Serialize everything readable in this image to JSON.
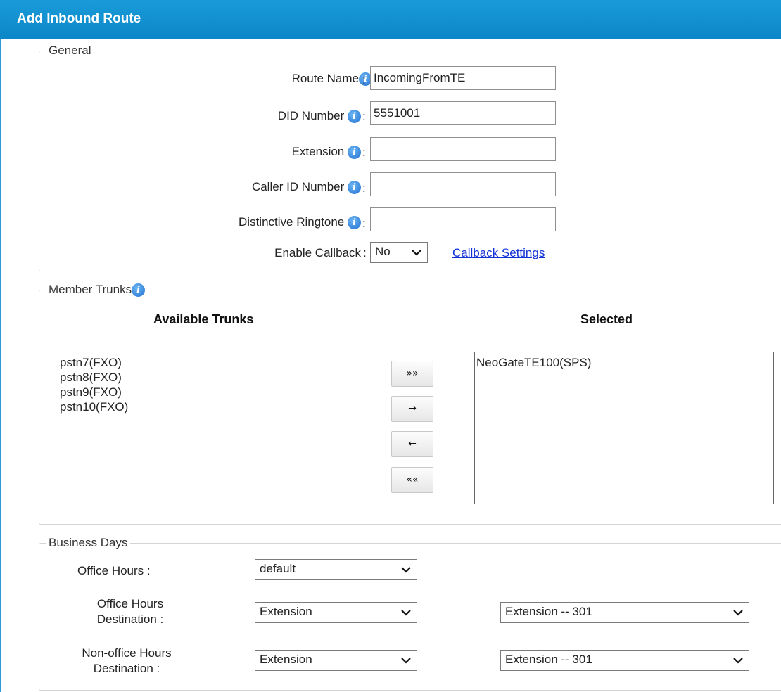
{
  "header": {
    "title": "Add Inbound Route"
  },
  "general": {
    "legend": "General",
    "route_name": {
      "label": "Route Name",
      "value": "IncomingFromTE"
    },
    "did_number": {
      "label": "DID Number",
      "value": "5551001"
    },
    "extension": {
      "label": "Extension",
      "value": ""
    },
    "caller_id_number": {
      "label": "Caller ID Number",
      "value": ""
    },
    "distinctive_ringtone": {
      "label": "Distinctive Ringtone",
      "value": ""
    },
    "enable_callback": {
      "label": "Enable Callback",
      "value": "No"
    },
    "callback_settings_link": "Callback Settings",
    "colon": ":"
  },
  "member_trunks": {
    "legend": "Member Trunks",
    "available_heading": "Available Trunks",
    "selected_heading": "Selected",
    "available": [
      "pstn7(FXO)",
      "pstn8(FXO)",
      "pstn9(FXO)",
      "pstn10(FXO)"
    ],
    "selected": [
      "NeoGateTE100(SPS)"
    ],
    "buttons": {
      "add_all": "»»",
      "add": "→",
      "remove": "←",
      "remove_all": "««"
    }
  },
  "business_days": {
    "legend": "Business Days",
    "office_hours": {
      "label": "Office Hours :",
      "value": "default"
    },
    "office_hours_destination": {
      "label_line1": "Office Hours",
      "label_line2": "Destination :",
      "type": "Extension",
      "target": "Extension -- 301"
    },
    "non_office_hours_destination": {
      "label_line1": "Non-office Hours",
      "label_line2": "Destination :",
      "type": "Extension",
      "target": "Extension -- 301"
    }
  },
  "colors": {
    "header": "#0b86c8",
    "link": "#1030d8",
    "info_icon": "#1f6fd0"
  }
}
